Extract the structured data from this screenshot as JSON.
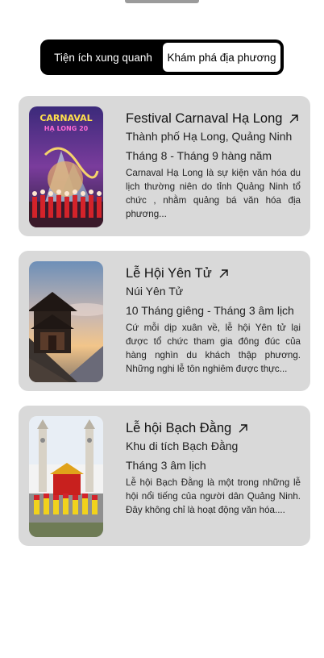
{
  "tabs": {
    "nearby_label": "Tiện ích xung quanh",
    "explore_label": "Khám phá địa phương"
  },
  "events": [
    {
      "title": "Festival Carnaval Hạ Long",
      "location": "Thành phố Hạ Long, Quảng Ninh",
      "time": "Tháng 8 - Tháng 9 hàng năm",
      "description": "Carnaval Hạ Long là sự kiện văn hóa du lịch thường niên do tỉnh Quảng Ninh tổ chức , nhằm quảng bá văn hóa địa phương...",
      "image_text": "CARNAVAL HẠ LONG 20"
    },
    {
      "title": "Lễ Hội Yên Tử",
      "location": "Núi Yên Tử",
      "time": "10 Tháng giêng - Tháng 3 âm lịch",
      "description": "Cứ mỗi dịp xuân về, lễ hội Yên tử lại được tổ chức tham gia đông đúc của hàng nghìn du khách thập phương. Những nghi lễ tôn nghiêm được thực..."
    },
    {
      "title": "Lễ hội Bạch Đằng",
      "location": "Khu di tích Bạch Đằng",
      "time": "Tháng 3 âm lịch",
      "description": "Lễ hội Bạch Đằng là một trong những lễ hội nổi tiếng của người dân Quảng Ninh. Đây không chỉ là hoạt động văn hóa...."
    }
  ],
  "icons": {
    "external_link": "arrow-up-right-icon"
  }
}
